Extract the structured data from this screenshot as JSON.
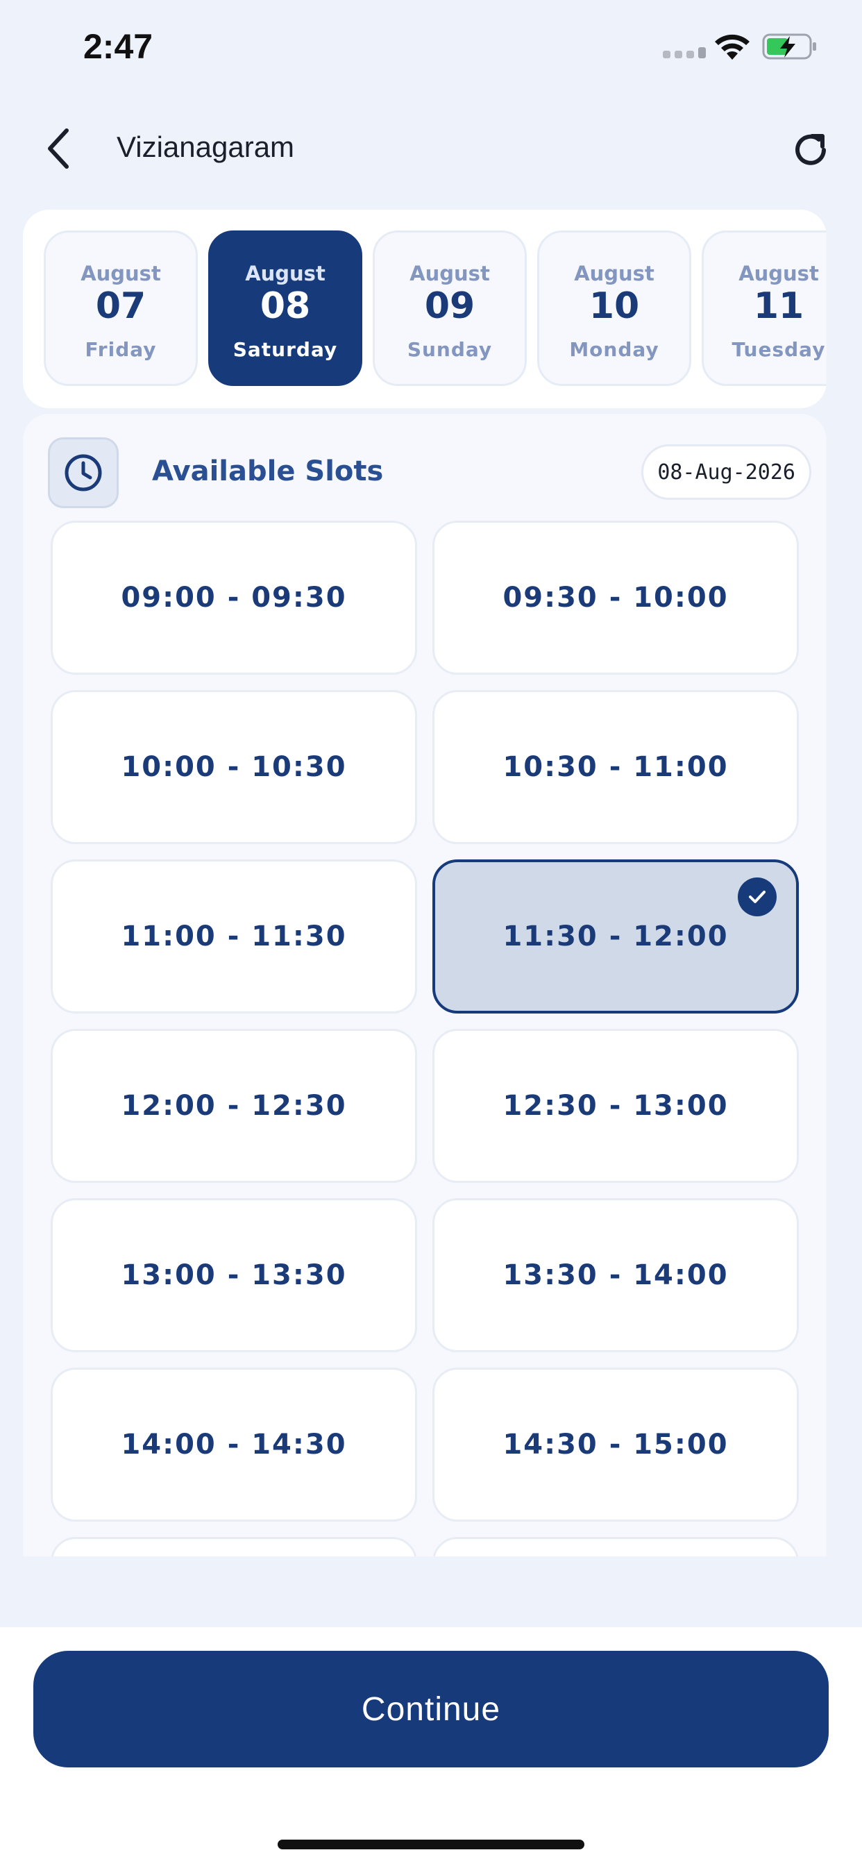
{
  "status_bar": {
    "time": "2:47",
    "icons": [
      "signal-icon",
      "wifi-icon",
      "battery-charging-icon"
    ]
  },
  "header": {
    "back_icon": "chevron-left-icon",
    "title": "Vizianagaram",
    "refresh_icon": "refresh-icon"
  },
  "dates": [
    {
      "month": "August",
      "day": "07",
      "weekday": "Friday",
      "selected": false
    },
    {
      "month": "August",
      "day": "08",
      "weekday": "Saturday",
      "selected": true
    },
    {
      "month": "August",
      "day": "09",
      "weekday": "Sunday",
      "selected": false
    },
    {
      "month": "August",
      "day": "10",
      "weekday": "Monday",
      "selected": false
    },
    {
      "month": "August",
      "day": "11",
      "weekday": "Tuesday",
      "selected": false
    }
  ],
  "slots_section": {
    "icon": "clock-icon",
    "title": "Available Slots",
    "selected_date": "08-Aug-2026"
  },
  "slots": [
    {
      "label": "09:00 - 09:30",
      "selected": false
    },
    {
      "label": "09:30 - 10:00",
      "selected": false
    },
    {
      "label": "10:00 - 10:30",
      "selected": false
    },
    {
      "label": "10:30 - 11:00",
      "selected": false
    },
    {
      "label": "11:00 - 11:30",
      "selected": false
    },
    {
      "label": "11:30 - 12:00",
      "selected": true
    },
    {
      "label": "12:00 - 12:30",
      "selected": false
    },
    {
      "label": "12:30 - 13:00",
      "selected": false
    },
    {
      "label": "13:00 - 13:30",
      "selected": false
    },
    {
      "label": "13:30 - 14:00",
      "selected": false
    },
    {
      "label": "14:00 - 14:30",
      "selected": false
    },
    {
      "label": "14:30 - 15:00",
      "selected": false
    }
  ],
  "footer": {
    "continue_label": "Continue"
  },
  "colors": {
    "primary": "#173a7b",
    "background": "#eef2fb",
    "selected_slot": "#d0d9e8",
    "muted_text": "#8396c0"
  }
}
